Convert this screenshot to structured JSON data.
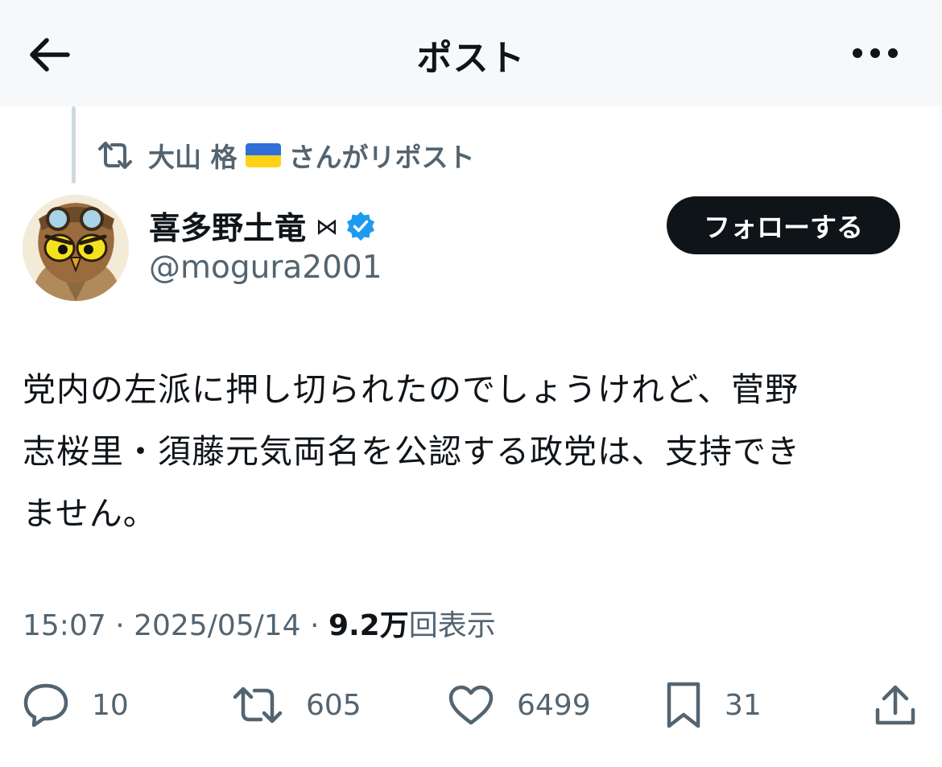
{
  "header": {
    "title": "ポスト"
  },
  "repost": {
    "name": "大山 格",
    "suffix": "さんがリポスト"
  },
  "author": {
    "display_name": "喜多野土竜",
    "badge_glyph": "⋈",
    "handle": "@mogura2001"
  },
  "follow_button": {
    "label": "フォローする"
  },
  "tweet": {
    "text": "党内の左派に押し切られたのでしょうけれど、菅野\n志桜里・須藤元気両名を公認する政党は、支持でき\nません。"
  },
  "meta": {
    "time": "15:07",
    "separator": " · ",
    "date": "2025/05/14",
    "views_count": "9.2万",
    "views_label": "回表示"
  },
  "actions": {
    "replies": "10",
    "reposts": "605",
    "likes": "6499",
    "bookmarks": "31"
  },
  "colors": {
    "text": "#0f1419",
    "secondary": "#536471",
    "verified": "#1d9bf0",
    "follow_bg": "#0f1419",
    "header_bg": "#f7f8f9",
    "flag_blue": "#2f6fd6",
    "flag_yellow": "#ffd21a"
  },
  "icons": [
    "back-arrow-icon",
    "more-icon",
    "repost-icon",
    "ukraine-flag-icon",
    "verified-icon",
    "reply-icon",
    "heart-icon",
    "bookmark-icon",
    "share-icon"
  ]
}
